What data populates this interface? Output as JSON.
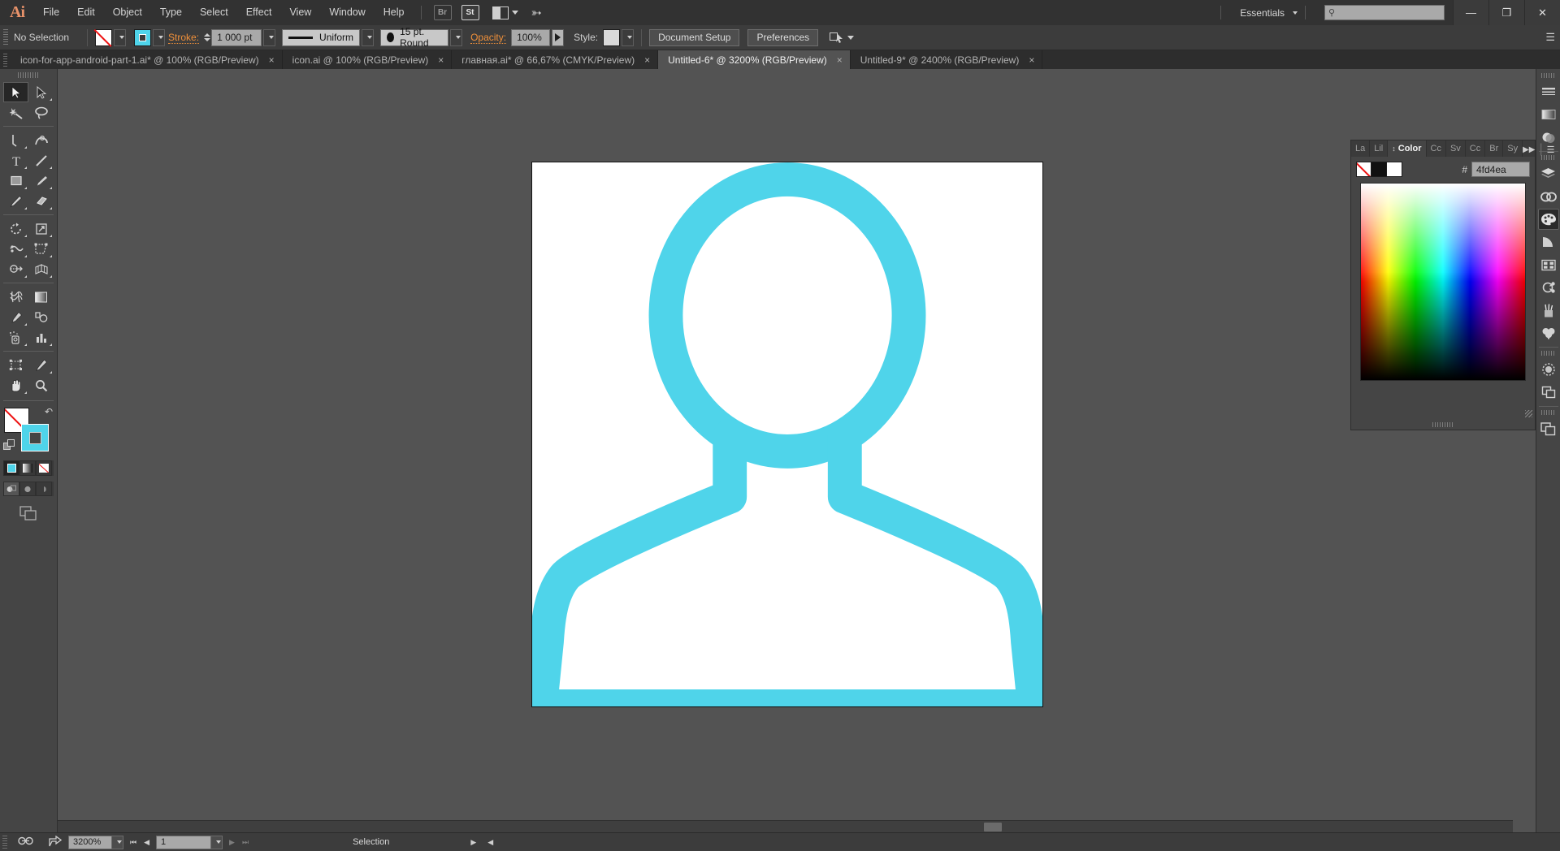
{
  "app": {
    "logo": "Ai",
    "workspace": "Essentials",
    "search_placeholder": ""
  },
  "menubar": {
    "items": [
      "File",
      "Edit",
      "Object",
      "Type",
      "Select",
      "Effect",
      "View",
      "Window",
      "Help"
    ],
    "bridge_label": "Br",
    "stock_label": "St",
    "arrange_name": "arrange-documents",
    "window_controls": {
      "minimize": "—",
      "restore": "❐",
      "close": "✕"
    }
  },
  "controlbar": {
    "selection_status": "No Selection",
    "fill_label": "Fill",
    "stroke_label": "Stroke:",
    "stroke_weight": "1 000 pt",
    "stroke_profile": "Uniform",
    "brush_definition": "15 pt. Round",
    "opacity_label": "Opacity:",
    "opacity_value": "100%",
    "style_label": "Style:",
    "document_setup": "Document Setup",
    "preferences": "Preferences"
  },
  "tabs": [
    {
      "label": "icon-for-app-android-part-1.ai* @ 100% (RGB/Preview)",
      "active": false,
      "close": "×"
    },
    {
      "label": "icon.ai @ 100% (RGB/Preview)",
      "active": false,
      "close": "×"
    },
    {
      "label": "главная.ai* @ 66,67% (CMYK/Preview)",
      "active": false,
      "close": "×"
    },
    {
      "label": "Untitled-6* @ 3200% (RGB/Preview)",
      "active": true,
      "close": "×"
    },
    {
      "label": "Untitled-9* @ 2400% (RGB/Preview)",
      "active": false,
      "close": "×"
    }
  ],
  "toolbar": {
    "tools": [
      {
        "name": "selection-tool",
        "selected": true,
        "corner": false
      },
      {
        "name": "direct-selection-tool",
        "selected": false,
        "corner": true
      },
      {
        "name": "magic-wand-tool",
        "selected": false,
        "corner": false
      },
      {
        "name": "lasso-tool",
        "selected": false,
        "corner": false
      },
      {
        "name": "pen-tool",
        "selected": false,
        "corner": true
      },
      {
        "name": "curvature-tool",
        "selected": false,
        "corner": false
      },
      {
        "name": "type-tool",
        "selected": false,
        "corner": true
      },
      {
        "name": "line-segment-tool",
        "selected": false,
        "corner": true
      },
      {
        "name": "rectangle-tool",
        "selected": false,
        "corner": true
      },
      {
        "name": "paintbrush-tool",
        "selected": false,
        "corner": true
      },
      {
        "name": "pencil-tool",
        "selected": false,
        "corner": true
      },
      {
        "name": "eraser-tool",
        "selected": false,
        "corner": true
      },
      {
        "name": "rotate-tool",
        "selected": false,
        "corner": true
      },
      {
        "name": "scale-tool",
        "selected": false,
        "corner": true
      },
      {
        "name": "width-tool",
        "selected": false,
        "corner": true
      },
      {
        "name": "free-transform-tool",
        "selected": false,
        "corner": true
      },
      {
        "name": "shape-builder-tool",
        "selected": false,
        "corner": true
      },
      {
        "name": "perspective-grid-tool",
        "selected": false,
        "corner": true
      },
      {
        "name": "mesh-tool",
        "selected": false,
        "corner": false
      },
      {
        "name": "gradient-tool",
        "selected": false,
        "corner": false
      },
      {
        "name": "eyedropper-tool",
        "selected": false,
        "corner": true
      },
      {
        "name": "blend-tool",
        "selected": false,
        "corner": false
      },
      {
        "name": "symbol-sprayer-tool",
        "selected": false,
        "corner": true
      },
      {
        "name": "column-graph-tool",
        "selected": false,
        "corner": true
      },
      {
        "name": "artboard-tool",
        "selected": false,
        "corner": false
      },
      {
        "name": "slice-tool",
        "selected": false,
        "corner": true
      },
      {
        "name": "hand-tool",
        "selected": false,
        "corner": true
      },
      {
        "name": "zoom-tool",
        "selected": false,
        "corner": false
      }
    ],
    "fill_state": "none",
    "stroke_color": "#4fd4ea",
    "drawing_modes": [
      "draw-normal",
      "draw-behind",
      "draw-inside"
    ],
    "screen_modes": [
      "normal-screen-mode",
      "full-screen-with-menu",
      "full-screen"
    ]
  },
  "right_rail": {
    "icons": [
      {
        "name": "stroke-panel-icon",
        "active": false
      },
      {
        "name": "gradient-panel-icon",
        "active": false
      },
      {
        "name": "transparency-panel-icon",
        "active": false
      },
      {
        "name": "layers-panel-icon",
        "active": false
      },
      {
        "name": "cc-libraries-panel-icon",
        "active": false
      },
      {
        "name": "color-panel-icon",
        "active": true
      },
      {
        "name": "color-guide-panel-icon",
        "active": false
      },
      {
        "name": "swatches-panel-icon",
        "active": false
      },
      {
        "name": "symbols-panel-icon",
        "active": false
      },
      {
        "name": "brushes-panel-icon",
        "active": false
      },
      {
        "name": "graphic-styles-panel-icon",
        "active": false
      },
      {
        "name": "appearance-panel-icon",
        "active": false
      },
      {
        "name": "pathfinder-panel-icon",
        "active": false
      },
      {
        "name": "artboards-panel-icon",
        "active": false
      }
    ]
  },
  "color_panel": {
    "tabs": [
      {
        "label": "La",
        "active": false
      },
      {
        "label": "Lil",
        "active": false
      },
      {
        "label": "Color",
        "active": true
      },
      {
        "label": "Cc",
        "active": false
      },
      {
        "label": "Sv",
        "active": false
      },
      {
        "label": "Cc",
        "active": false
      },
      {
        "label": "Br",
        "active": false
      },
      {
        "label": "Sy",
        "active": false
      }
    ],
    "hash_symbol": "#",
    "hex_value": "4fd4ea",
    "swatches": [
      "none",
      "#000000",
      "#ffffff"
    ],
    "expand_icon": "▶▶",
    "menu_icon": "☰"
  },
  "canvas": {
    "artwork_name": "user-avatar-outline-artwork",
    "artwork_color": "#4fd4ea",
    "artboard_background": "#ffffff"
  },
  "statusbar": {
    "zoom_level": "3200%",
    "artboard_number": "1",
    "status_text": "Selection",
    "first_icon": "cut-preview-icon",
    "share_icon": "share-icon",
    "nav_first": "⏮",
    "nav_prev": "◀",
    "nav_next": "▶",
    "nav_last": "⏭"
  }
}
